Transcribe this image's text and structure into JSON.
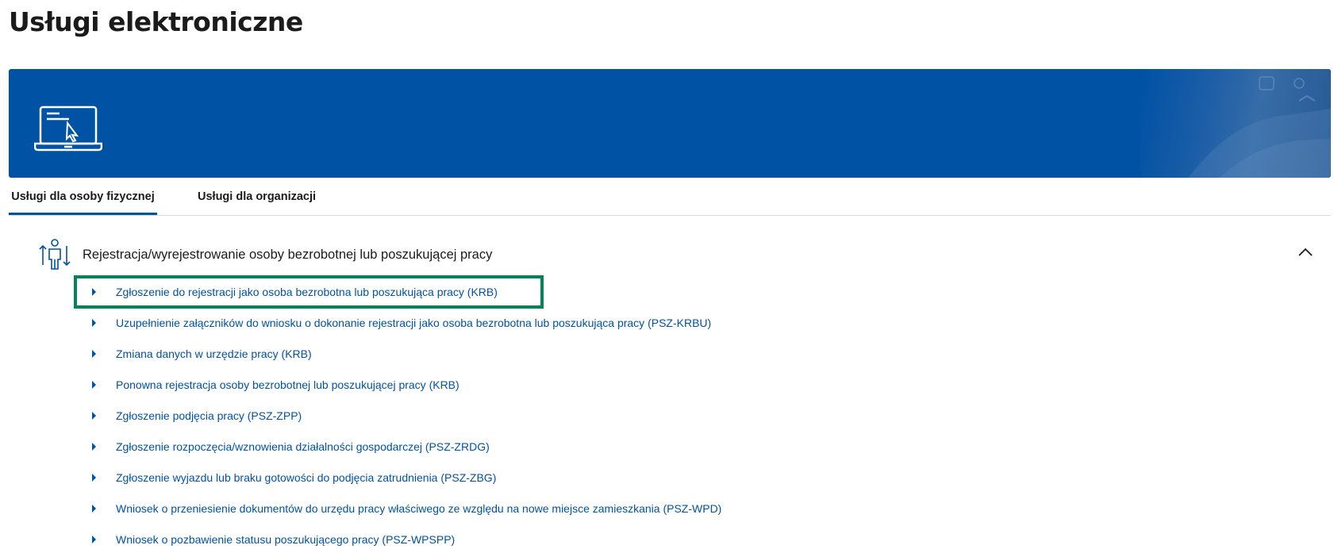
{
  "page": {
    "title": "Usługi elektroniczne"
  },
  "banner": {
    "icon": "laptop-cursor-icon"
  },
  "tabs": [
    {
      "label": "Usługi dla osoby fizycznej",
      "active": true
    },
    {
      "label": "Usługi dla organizacji",
      "active": false
    }
  ],
  "section": {
    "icon": "person-up-down-arrows-icon",
    "title": "Rejestracja/wyrejestrowanie osoby bezrobotnej lub poszukującej pracy",
    "collapse_icon": "chevron-up-icon",
    "items": [
      {
        "label": "Zgłoszenie do rejestracji jako osoba bezrobotna lub poszukująca pracy (KRB)"
      },
      {
        "label": "Uzupełnienie załączników do wniosku o dokonanie rejestracji jako osoba bezrobotna lub poszukująca pracy (PSZ-KRBU)"
      },
      {
        "label": "Zmiana danych w urzędzie pracy (KRB)"
      },
      {
        "label": "Ponowna rejestracja osoby bezrobotnej lub poszukującej pracy (KRB)"
      },
      {
        "label": "Zgłoszenie podjęcia pracy (PSZ-ZPP)"
      },
      {
        "label": "Zgłoszenie rozpoczęcia/wznowienia działalności gospodarczej (PSZ-ZRDG)"
      },
      {
        "label": "Zgłoszenie wyjazdu lub braku gotowości do podjęcia zatrudnienia (PSZ-ZBG)"
      },
      {
        "label": "Wniosek o przeniesienie dokumentów do urzędu pracy właściwego ze względu na nowe miejsce zamieszkania (PSZ-WPD)"
      },
      {
        "label": "Wniosek o pozbawienie statusu poszukującego pracy (PSZ-WPSPP)"
      }
    ]
  },
  "colors": {
    "brand": "#0052a5",
    "link": "#0052a5",
    "highlight": "#00855a"
  }
}
